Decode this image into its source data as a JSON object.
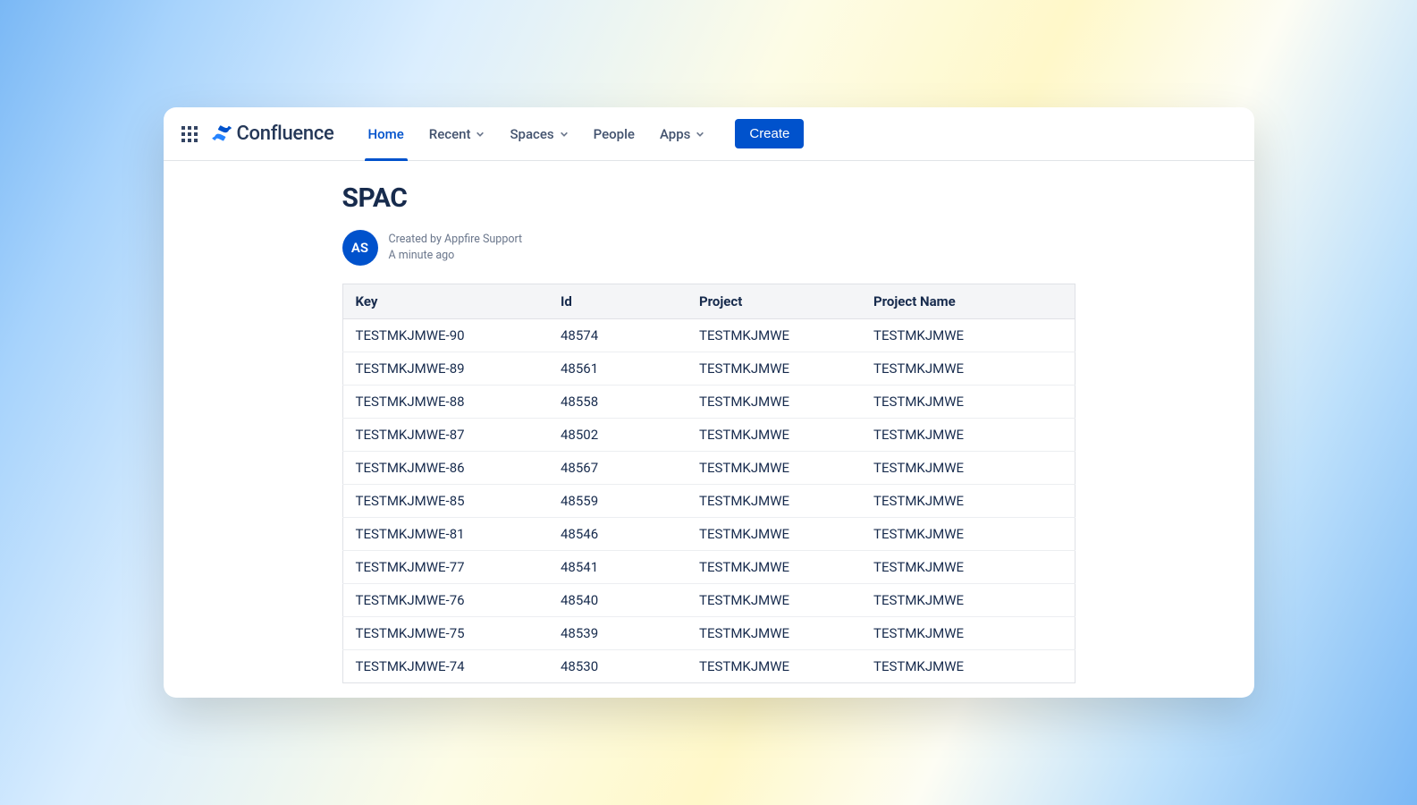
{
  "brand": {
    "name": "Confluence"
  },
  "nav": {
    "home": "Home",
    "recent": "Recent",
    "spaces": "Spaces",
    "people": "People",
    "apps": "Apps",
    "create": "Create"
  },
  "page": {
    "title": "SPAC",
    "avatar_initials": "AS",
    "created_by": "Created by Appfire Support",
    "timestamp": "A minute ago"
  },
  "table": {
    "headers": {
      "key": "Key",
      "id": "Id",
      "project": "Project",
      "project_name": "Project Name"
    },
    "rows": [
      {
        "key": "TESTMKJMWE-90",
        "id": "48574",
        "project": "TESTMKJMWE",
        "project_name": "TESTMKJMWE"
      },
      {
        "key": "TESTMKJMWE-89",
        "id": "48561",
        "project": "TESTMKJMWE",
        "project_name": "TESTMKJMWE"
      },
      {
        "key": "TESTMKJMWE-88",
        "id": "48558",
        "project": "TESTMKJMWE",
        "project_name": "TESTMKJMWE"
      },
      {
        "key": "TESTMKJMWE-87",
        "id": "48502",
        "project": "TESTMKJMWE",
        "project_name": "TESTMKJMWE"
      },
      {
        "key": "TESTMKJMWE-86",
        "id": "48567",
        "project": "TESTMKJMWE",
        "project_name": "TESTMKJMWE"
      },
      {
        "key": "TESTMKJMWE-85",
        "id": "48559",
        "project": "TESTMKJMWE",
        "project_name": "TESTMKJMWE"
      },
      {
        "key": "TESTMKJMWE-81",
        "id": "48546",
        "project": "TESTMKJMWE",
        "project_name": "TESTMKJMWE"
      },
      {
        "key": "TESTMKJMWE-77",
        "id": "48541",
        "project": "TESTMKJMWE",
        "project_name": "TESTMKJMWE"
      },
      {
        "key": "TESTMKJMWE-76",
        "id": "48540",
        "project": "TESTMKJMWE",
        "project_name": "TESTMKJMWE"
      },
      {
        "key": "TESTMKJMWE-75",
        "id": "48539",
        "project": "TESTMKJMWE",
        "project_name": "TESTMKJMWE"
      },
      {
        "key": "TESTMKJMWE-74",
        "id": "48530",
        "project": "TESTMKJMWE",
        "project_name": "TESTMKJMWE"
      }
    ]
  }
}
